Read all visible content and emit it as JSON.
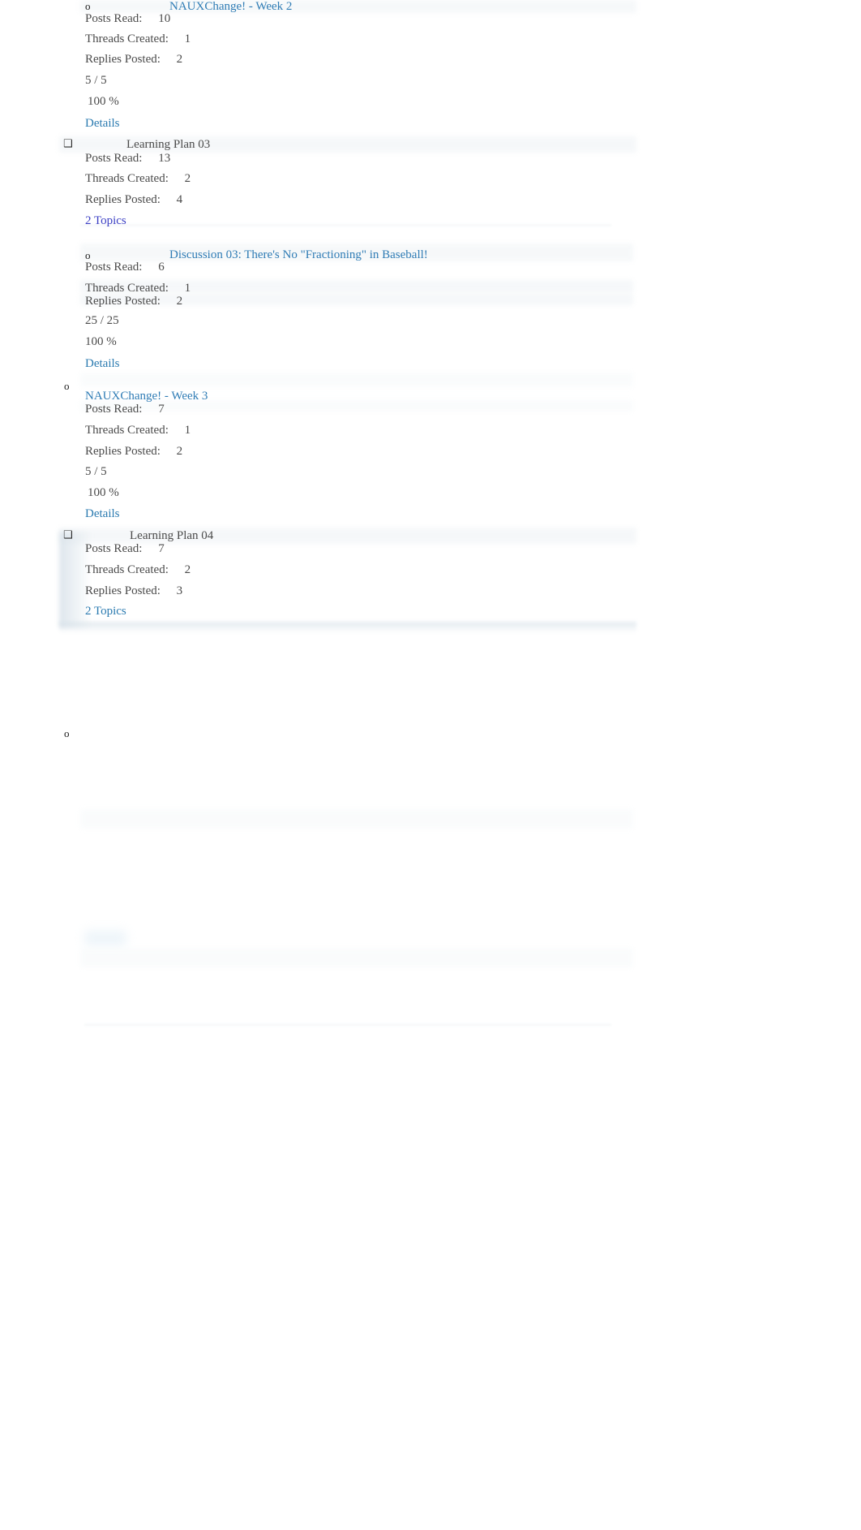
{
  "page": {
    "title": "Discussion Board Participation Report",
    "link_color": "#2a7ab0",
    "visited_link_color": "#3b3fc4",
    "text_color": "#444444",
    "bullet_glyph": "o",
    "plan_glyph": "❑"
  },
  "labels": {
    "posts_read": "Posts Read:",
    "threads_created": "Threads Created:",
    "replies_posted": "Replies Posted:",
    "details": "Details"
  },
  "sections": [
    {
      "type": "forum",
      "bullet": "o",
      "title": "NAUXChange! - Week 2",
      "posts_read": "10",
      "threads_created": "1",
      "replies_posted": "2",
      "score": "5 / 5",
      "percent": "100 %",
      "details": "Details"
    },
    {
      "type": "plan",
      "glyph": "❑",
      "title": "Learning Plan 03",
      "posts_read": "13",
      "threads_created": "2",
      "replies_posted": "4",
      "topics": "2 Topics"
    },
    {
      "type": "forum",
      "bullet": "o",
      "title": "Discussion 03: There's No \"Fractioning\" in Baseball!",
      "posts_read": "6",
      "threads_created": "1",
      "replies_posted": "2",
      "score": "25 / 25",
      "percent": "100 %",
      "details": "Details"
    },
    {
      "type": "forum",
      "bullet": "o",
      "title": "NAUXChange! - Week 3",
      "posts_read": "7",
      "threads_created": "1",
      "replies_posted": "2",
      "score": "5 / 5",
      "percent": "100 %",
      "details": "Details"
    },
    {
      "type": "plan",
      "glyph": "❑",
      "title": "Learning Plan 04",
      "posts_read": "7",
      "threads_created": "2",
      "replies_posted": "3",
      "topics": "2 Topics"
    },
    {
      "type": "orphan-bullet",
      "bullet": "o"
    }
  ]
}
